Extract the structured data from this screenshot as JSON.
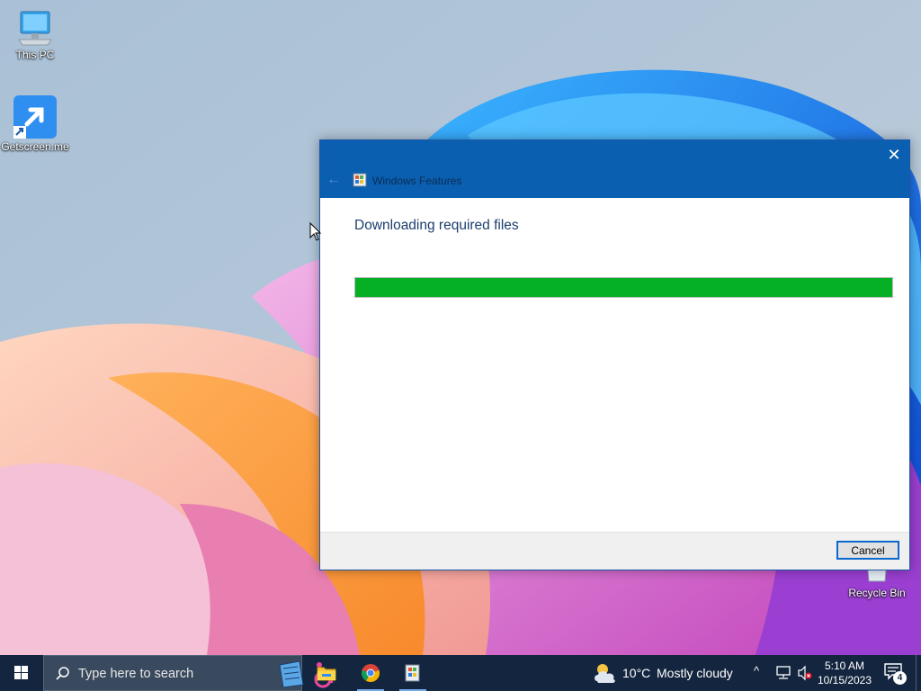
{
  "desktop": {
    "icons": [
      {
        "label": "This PC"
      },
      {
        "label": "Getscreen.me"
      },
      {
        "label": "Recycle Bin"
      }
    ]
  },
  "dialog": {
    "title": "Windows Features",
    "heading": "Downloading required files",
    "progress_percent": 100,
    "close_symbol": "✕",
    "back_symbol": "←",
    "cancel_label": "Cancel",
    "progress_color": "#06b025",
    "titlebar_color": "#0a5fb0"
  },
  "taskbar": {
    "search_placeholder": "Type here to search",
    "apps": [
      {
        "name": "file-explorer",
        "icon": "folder-icon"
      },
      {
        "name": "google-chrome",
        "icon": "chrome-icon"
      },
      {
        "name": "windows-features",
        "icon": "windows-features-icon"
      }
    ],
    "weather": {
      "temp": "10°C",
      "desc": "Mostly cloudy"
    },
    "tray_chevron": "^",
    "clock": {
      "time": "5:10 AM",
      "date": "10/15/2023"
    },
    "notification_count": "4"
  }
}
